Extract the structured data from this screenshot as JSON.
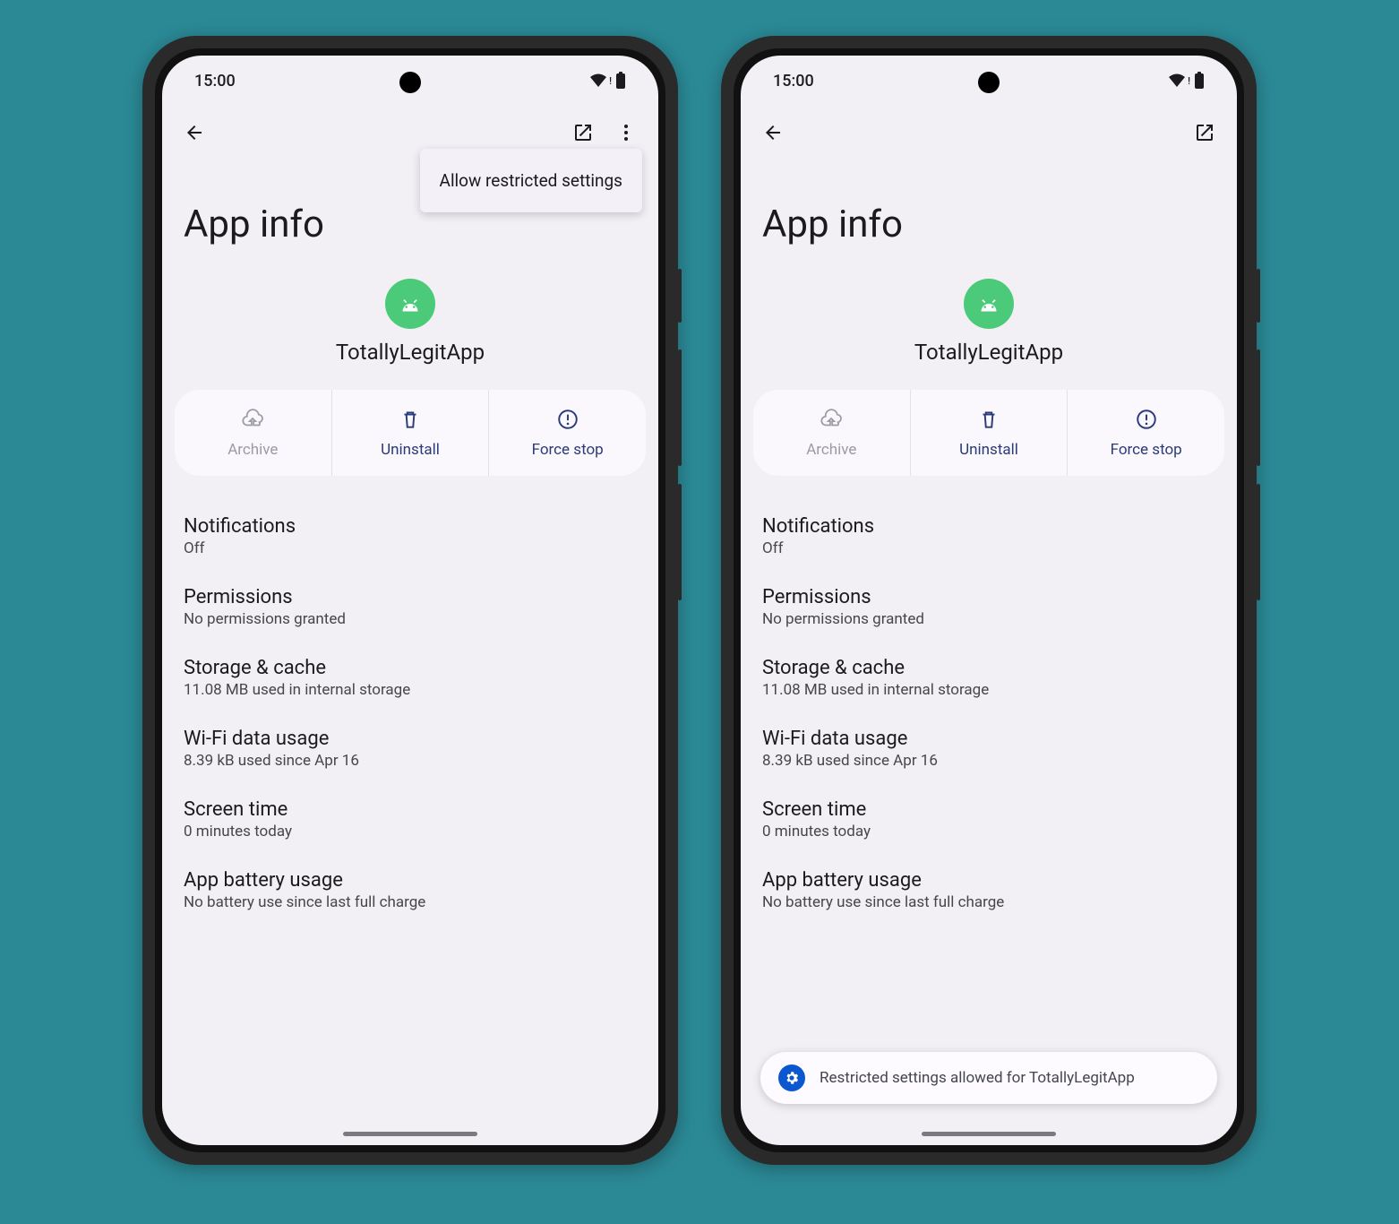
{
  "status": {
    "time": "15:00"
  },
  "page_title": "App info",
  "app": {
    "name": "TotallyLegitApp"
  },
  "actions": {
    "archive": "Archive",
    "uninstall": "Uninstall",
    "force_stop": "Force stop"
  },
  "settings": [
    {
      "title": "Notifications",
      "sub": "Off"
    },
    {
      "title": "Permissions",
      "sub": "No permissions granted"
    },
    {
      "title": "Storage & cache",
      "sub": "11.08 MB used in internal storage"
    },
    {
      "title": "Wi-Fi data usage",
      "sub": "8.39 kB used since Apr 16"
    },
    {
      "title": "Screen time",
      "sub": "0 minutes today"
    },
    {
      "title": "App battery usage",
      "sub": "No battery use since last full charge"
    }
  ],
  "dropdown": {
    "item1": "Allow restricted settings"
  },
  "snackbar": {
    "text": "Restricted settings allowed for TotallyLegitApp"
  }
}
